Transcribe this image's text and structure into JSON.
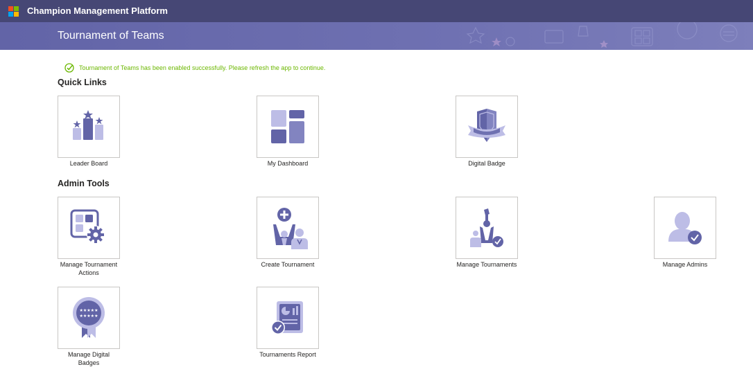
{
  "app": {
    "title": "Champion Management Platform"
  },
  "banner": {
    "title": "Tournament of Teams"
  },
  "message": {
    "success": "Tournament of Teams has been enabled successfully. Please refresh the app to continue."
  },
  "sections": {
    "quick_links": "Quick Links",
    "admin_tools": "Admin Tools"
  },
  "quick_links": {
    "leader_board": "Leader Board",
    "my_dashboard": "My Dashboard",
    "digital_badge": "Digital Badge"
  },
  "admin_tools": {
    "manage_tournament_actions_1": "Manage Tournament",
    "manage_tournament_actions_2": "Actions",
    "create_tournament": "Create Tournament",
    "manage_tournaments": "Manage Tournaments",
    "manage_admins": "Manage Admins",
    "manage_digital_badges_1": "Manage Digital",
    "manage_digital_badges_2": "Badges",
    "tournaments_report": "Tournaments Report"
  },
  "colors": {
    "topbar": "#464775",
    "banner": "#6264a7",
    "icon_dark": "#6264a7",
    "icon_light": "#bdbde6",
    "success": "#6bb700"
  },
  "icons": {
    "leader_board": "podium-stars-icon",
    "my_dashboard": "dashboard-grid-icon",
    "digital_badge": "shield-ribbon-icon",
    "manage_tournament_actions": "grid-gear-icon",
    "create_tournament": "person-add-icon",
    "manage_tournaments": "trophy-people-check-icon",
    "manage_admins": "person-check-icon",
    "manage_digital_badges": "rosette-badge-icon",
    "tournaments_report": "report-check-icon"
  }
}
